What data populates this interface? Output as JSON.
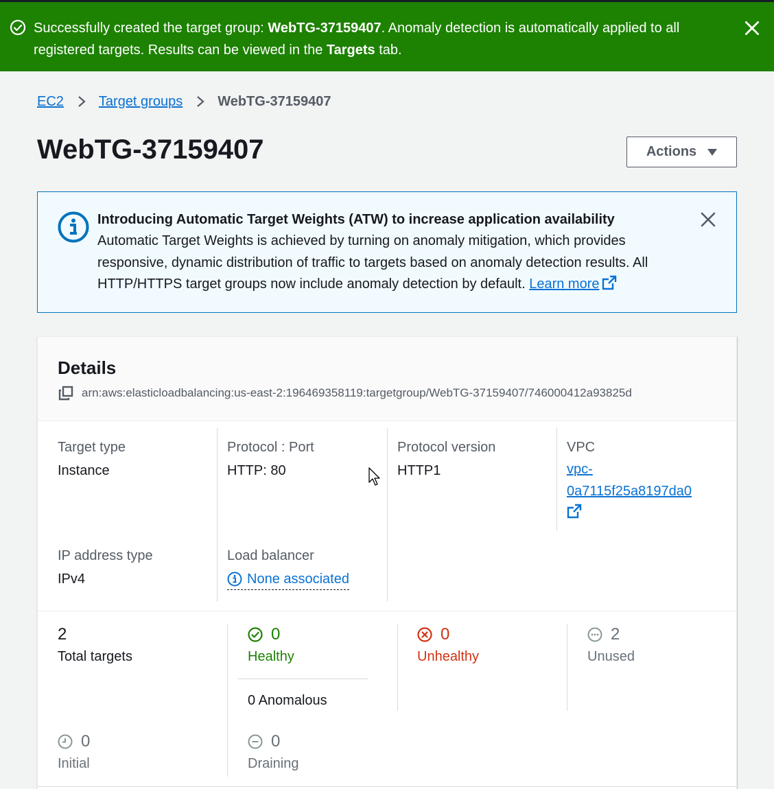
{
  "flash": {
    "prefix": "Successfully created the target group: ",
    "name": "WebTG-37159407",
    "middle": ". Anomaly detection is automatically applied to all registered targets. Results can be viewed in the ",
    "tab": "Targets",
    "suffix": " tab.",
    "color": "#1d8102"
  },
  "breadcrumb": {
    "items": [
      "EC2",
      "Target groups"
    ],
    "current": "WebTG-37159407"
  },
  "page": {
    "title": "WebTG-37159407",
    "actions_label": "Actions"
  },
  "info": {
    "title": "Introducing Automatic Target Weights (ATW) to increase application availability",
    "body": "Automatic Target Weights is achieved by turning on anomaly mitigation, which provides responsive, dynamic distribution of traffic to targets based on anomaly detection results. All HTTP/HTTPS target groups now include anomaly detection by default. ",
    "learn_more": "Learn more"
  },
  "details": {
    "heading": "Details",
    "arn": "arn:aws:elasticloadbalancing:us-east-2:196469358119:targetgroup/WebTG-37159407/746000412a93825d",
    "target_type_label": "Target type",
    "target_type": "Instance",
    "protocol_port_label": "Protocol : Port",
    "protocol_port": "HTTP: 80",
    "protocol_version_label": "Protocol version",
    "protocol_version": "HTTP1",
    "vpc_label": "VPC",
    "vpc_line1": "vpc-",
    "vpc_line2": "0a7115f25a8197da0",
    "ip_type_label": "IP address type",
    "ip_type": "IPv4",
    "lb_label": "Load balancer",
    "lb_value": "None associated"
  },
  "stats": {
    "total": "2",
    "total_label": "Total targets",
    "healthy": "0",
    "healthy_label": "Healthy",
    "anomalous": "0 Anomalous",
    "unhealthy": "0",
    "unhealthy_label": "Unhealthy",
    "unused": "2",
    "unused_label": "Unused",
    "initial": "0",
    "initial_label": "Initial",
    "draining": "0",
    "draining_label": "Draining"
  },
  "icons": {
    "flash": "check-circle-icon",
    "info": "info-circle-icon",
    "copy": "copy-icon",
    "external": "external-link-icon"
  }
}
